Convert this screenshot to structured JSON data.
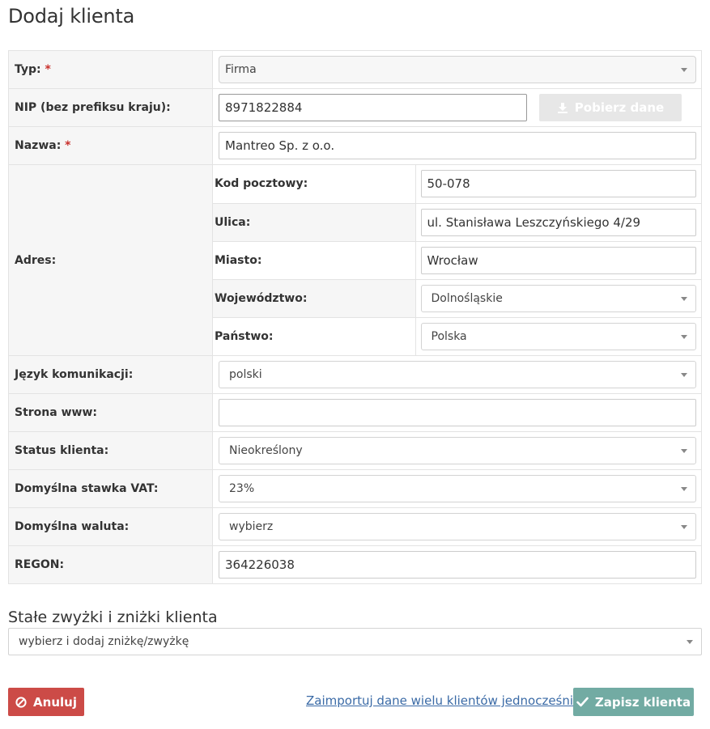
{
  "page": {
    "title": "Dodaj klienta"
  },
  "form": {
    "type": {
      "label": "Typ:",
      "required_mark": "*",
      "value": "Firma"
    },
    "nip": {
      "label": "NIP (bez prefiksu kraju):",
      "value": "8971822884",
      "fetch_button": "Pobierz dane"
    },
    "name": {
      "label": "Nazwa:",
      "required_mark": "*",
      "value": "Mantreo Sp. z o.o."
    },
    "address": {
      "label": "Adres:",
      "postal_code": {
        "label": "Kod pocztowy:",
        "value": "50-078"
      },
      "street": {
        "label": "Ulica:",
        "value": "ul. Stanisława Leszczyńskiego 4/29"
      },
      "city": {
        "label": "Miasto:",
        "value": "Wrocław"
      },
      "province": {
        "label": "Województwo:",
        "value": "Dolnośląskie"
      },
      "country": {
        "label": "Państwo:",
        "value": "Polska"
      }
    },
    "language": {
      "label": "Język komunikacji:",
      "value": "polski"
    },
    "website": {
      "label": "Strona www:",
      "value": ""
    },
    "status": {
      "label": "Status klienta:",
      "value": "Nieokreślony"
    },
    "vat": {
      "label": "Domyślna stawka VAT:",
      "value": "23%"
    },
    "currency": {
      "label": "Domyślna waluta:",
      "value": "wybierz"
    },
    "regon": {
      "label": "REGON:",
      "value": "364226038"
    }
  },
  "discounts": {
    "title": "Stałe zwyżki i zniżki klienta",
    "select_value": "wybierz i dodaj zniżkę/zwyżkę"
  },
  "actions": {
    "cancel": "Anuluj",
    "import_link": "Zaimportuj dane wielu klientów jednocześnie",
    "save": "Zapisz klienta"
  },
  "colors": {
    "cancel": "#cc4b47",
    "save": "#72aba3",
    "link": "#3a6aa6",
    "required": "#c9302c"
  },
  "icons": {
    "fetch": "download-icon",
    "cancel": "ban-icon",
    "save": "check-icon",
    "select": "caret-down-icon"
  }
}
